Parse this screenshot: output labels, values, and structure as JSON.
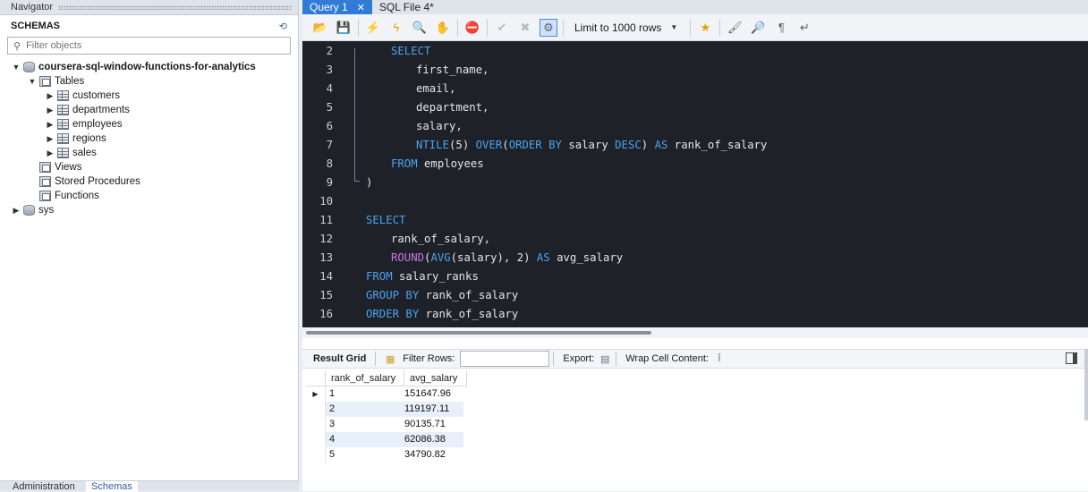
{
  "navigator": {
    "title": "Navigator",
    "header": "SCHEMAS",
    "filter_placeholder": "Filter objects",
    "schema": "coursera-sql-window-functions-for-analytics",
    "tables_label": "Tables",
    "tables": [
      "customers",
      "departments",
      "employees",
      "regions",
      "sales"
    ],
    "views_label": "Views",
    "procedures_label": "Stored Procedures",
    "functions_label": "Functions",
    "sys_label": "sys",
    "bottom_tabs": [
      "Administration",
      "Schemas"
    ]
  },
  "tabs": [
    {
      "label": "Query 1",
      "close": "✕"
    },
    {
      "label": "SQL File 4*"
    }
  ],
  "toolbar": {
    "limit_label": "Limit to 1000 rows"
  },
  "editor": {
    "line_numbers": [
      "2",
      "3",
      "4",
      "5",
      "6",
      "7",
      "8",
      "9",
      "10",
      "11",
      "12",
      "13",
      "14",
      "15",
      "16"
    ]
  },
  "results": {
    "result_grid_label": "Result Grid",
    "filter_rows_label": "Filter Rows:",
    "export_label": "Export:",
    "wrap_label": "Wrap Cell Content:",
    "columns": [
      "rank_of_salary",
      "avg_salary"
    ],
    "rows": [
      [
        "1",
        "151647.96"
      ],
      [
        "2",
        "119197.11"
      ],
      [
        "3",
        "90135.71"
      ],
      [
        "4",
        "62086.38"
      ],
      [
        "5",
        "34790.82"
      ]
    ]
  }
}
